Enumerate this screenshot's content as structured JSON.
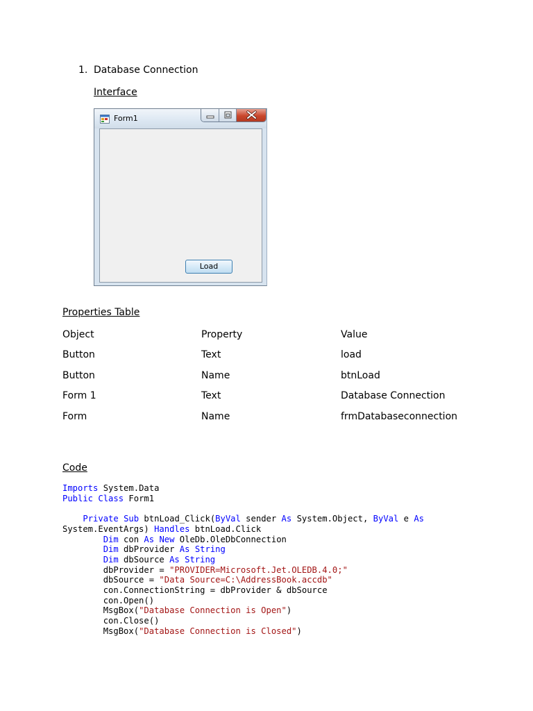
{
  "section": {
    "number": "1.",
    "title": "Database Connection",
    "interface_heading": "Interface"
  },
  "form_window": {
    "title": "Form1",
    "button_label": "Load",
    "colors": {
      "titlebar": "#dce7f2",
      "close": "#c9462c",
      "client": "#f0f0f0",
      "button_border": "#3c7fb1"
    }
  },
  "properties_table": {
    "heading": "Properties Table",
    "columns": [
      "Object",
      "Property",
      "Value"
    ],
    "rows": [
      [
        "Button",
        "Text",
        "load"
      ],
      [
        "Button",
        "Name",
        "btnLoad"
      ],
      [
        "Form 1",
        "Text",
        "Database Connection"
      ],
      [
        "Form",
        "Name",
        "frmDatabaseconnection"
      ]
    ]
  },
  "code_section": {
    "heading": "Code ",
    "colors": {
      "keyword": "#0000ff",
      "string": "#a31515",
      "text": "#000000"
    },
    "lines": [
      [
        {
          "t": "kw",
          "s": "Imports"
        },
        {
          "t": "n",
          "s": " System.Data"
        }
      ],
      [
        {
          "t": "kw",
          "s": "Public"
        },
        {
          "t": "n",
          "s": " "
        },
        {
          "t": "kw",
          "s": "Class"
        },
        {
          "t": "n",
          "s": " Form1"
        }
      ],
      [],
      [
        {
          "t": "n",
          "s": "    "
        },
        {
          "t": "kw",
          "s": "Private"
        },
        {
          "t": "n",
          "s": " "
        },
        {
          "t": "kw",
          "s": "Sub"
        },
        {
          "t": "n",
          "s": " btnLoad_Click("
        },
        {
          "t": "kw",
          "s": "ByVal"
        },
        {
          "t": "n",
          "s": " sender "
        },
        {
          "t": "kw",
          "s": "As"
        },
        {
          "t": "n",
          "s": " System.Object, "
        },
        {
          "t": "kw",
          "s": "ByVal"
        },
        {
          "t": "n",
          "s": " e "
        },
        {
          "t": "kw",
          "s": "As"
        }
      ],
      [
        {
          "t": "n",
          "s": "System.EventArgs) "
        },
        {
          "t": "kw",
          "s": "Handles"
        },
        {
          "t": "n",
          "s": " btnLoad.Click"
        }
      ],
      [
        {
          "t": "n",
          "s": "        "
        },
        {
          "t": "kw",
          "s": "Dim"
        },
        {
          "t": "n",
          "s": " con "
        },
        {
          "t": "kw",
          "s": "As"
        },
        {
          "t": "n",
          "s": " "
        },
        {
          "t": "kw",
          "s": "New"
        },
        {
          "t": "n",
          "s": " OleDb.OleDbConnection"
        }
      ],
      [
        {
          "t": "n",
          "s": "        "
        },
        {
          "t": "kw",
          "s": "Dim"
        },
        {
          "t": "n",
          "s": " dbProvider "
        },
        {
          "t": "kw",
          "s": "As"
        },
        {
          "t": "n",
          "s": " "
        },
        {
          "t": "kw",
          "s": "String"
        }
      ],
      [
        {
          "t": "n",
          "s": "        "
        },
        {
          "t": "kw",
          "s": "Dim"
        },
        {
          "t": "n",
          "s": " dbSource "
        },
        {
          "t": "kw",
          "s": "As"
        },
        {
          "t": "n",
          "s": " "
        },
        {
          "t": "kw",
          "s": "String"
        }
      ],
      [
        {
          "t": "n",
          "s": "        dbProvider = "
        },
        {
          "t": "str",
          "s": "\"PROVIDER=Microsoft.Jet.OLEDB.4.0;\""
        }
      ],
      [
        {
          "t": "n",
          "s": "        dbSource = "
        },
        {
          "t": "str",
          "s": "\"Data Source=C:\\AddressBook.accdb\""
        }
      ],
      [
        {
          "t": "n",
          "s": "        con.ConnectionString = dbProvider & dbSource"
        }
      ],
      [
        {
          "t": "n",
          "s": "        con.Open()"
        }
      ],
      [
        {
          "t": "n",
          "s": "        MsgBox("
        },
        {
          "t": "str",
          "s": "\"Database Connection is Open\""
        },
        {
          "t": "n",
          "s": ")"
        }
      ],
      [
        {
          "t": "n",
          "s": "        con.Close()"
        }
      ],
      [
        {
          "t": "n",
          "s": "        MsgBox("
        },
        {
          "t": "str",
          "s": "\"Database Connection is Closed\""
        },
        {
          "t": "n",
          "s": ")"
        }
      ]
    ]
  }
}
